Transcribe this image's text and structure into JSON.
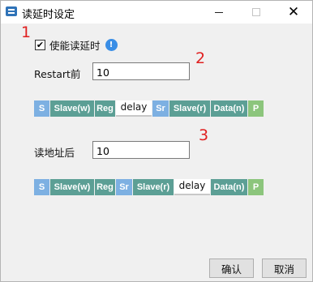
{
  "window": {
    "title": "读延时设定",
    "minimize_symbol": "",
    "maximize_symbol": "",
    "close_symbol": "✕",
    "app_icon": "app-icon"
  },
  "markers": [
    "1",
    "2",
    "3"
  ],
  "enable_delay": {
    "checked": true,
    "check_glyph": "✔",
    "label": "使能读延时",
    "info_glyph": "!"
  },
  "restart_before": {
    "label": "Restart前",
    "value": "10"
  },
  "after_address": {
    "label": "读地址后",
    "value": "10"
  },
  "sequence_1": [
    "S",
    "Slave(w)",
    "Reg",
    "delay",
    "Sr",
    "Slave(r)",
    "Data(n)",
    "P"
  ],
  "sequence_2": [
    "S",
    "Slave(w)",
    "Reg",
    "Sr",
    "Slave(r)",
    "delay",
    "Data(n)",
    "P"
  ],
  "colors": {
    "start_stop_blue": "#7db0e2",
    "field_teal": "#5c9f95",
    "stop_green": "#8cc57c",
    "marker_red": "#e02020"
  },
  "buttons": {
    "confirm": "确认",
    "cancel": "取消"
  }
}
